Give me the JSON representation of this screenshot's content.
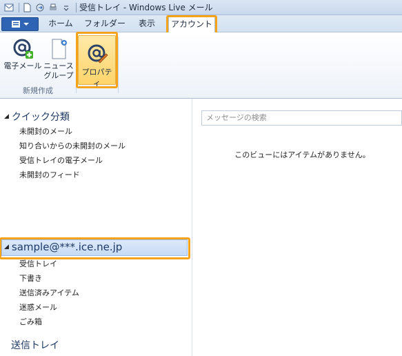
{
  "window": {
    "title": "受信トレイ - Windows Live メール"
  },
  "qat_icons": [
    "app-icon",
    "new-icon",
    "send-receive-icon",
    "dropdown-icon"
  ],
  "tabs": [
    {
      "label": "ホーム"
    },
    {
      "label": "フォルダー"
    },
    {
      "label": "表示"
    },
    {
      "label": "アカウント",
      "active": true
    }
  ],
  "ribbon": {
    "group_new_label": "新規作成",
    "email_label": "電子メール",
    "newsgroup_label_1": "ニュース",
    "newsgroup_label_2": "グループ",
    "properties_label": "プロパティ"
  },
  "quick_views": {
    "heading": "クイック分類",
    "items": [
      "未開封のメール",
      "知り合いからの未開封のメール",
      "受信トレイの電子メール",
      "未開封のフィード"
    ]
  },
  "account": {
    "name": "sample@***.ice.ne.jp",
    "folders": [
      "受信トレイ",
      "下書き",
      "送信済みアイテム",
      "迷惑メール",
      "ごみ箱"
    ]
  },
  "outbox": {
    "label": "送信トレイ"
  },
  "search": {
    "placeholder": "メッセージの検索"
  },
  "message_list": {
    "empty_text": "このビューにはアイテムがありません。"
  },
  "colors": {
    "highlight": "#f5a31a",
    "app_button": "#2f64b5",
    "selection": "#c7dbf5"
  }
}
